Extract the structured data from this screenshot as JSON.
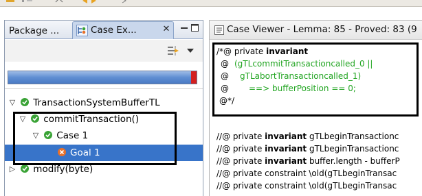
{
  "left_view": {
    "tabs": [
      {
        "label": "Package ..."
      },
      {
        "label": "Case Ex...",
        "active": true,
        "close": "✕"
      }
    ],
    "progress": {
      "value_fraction": 0.97,
      "error_color": "#d41f1f",
      "bar_color": "#5f8ed2"
    },
    "tree": [
      {
        "label": "TransactionSystemBufferTL",
        "status": "green",
        "expanded": true
      },
      {
        "label": "commitTransaction()",
        "status": "green",
        "expanded": true
      },
      {
        "label": "Case 1",
        "status": "green",
        "expanded": true
      },
      {
        "label": "Goal 1",
        "status": "orange",
        "selected": true
      },
      {
        "label": "modify(byte)",
        "status": "green",
        "expanded": false
      }
    ]
  },
  "right_view": {
    "title": "Case Viewer - Lemma: 85 - Proved: 83 (9",
    "code": {
      "l1_prefix": "/*@ private ",
      "l1_keyword": "invariant",
      "l2_at": "@",
      "l2_text": "(gTLcommitTransactioncalled_0 ||",
      "l3_at": "@",
      "l3_text": "gTLabortTransactioncalled_1)",
      "l4_at": "@",
      "l4_text": "==> bufferPosition == 0;",
      "l5": "@*/",
      "lines": [
        {
          "prefix": "//@ private ",
          "keyword": "invariant",
          "rest": " gTLbeginTransactionc"
        },
        {
          "prefix": "//@ private ",
          "keyword": "invariant",
          "rest": " gTLbeginTransactionc"
        },
        {
          "prefix": "//@ private ",
          "keyword": "invariant",
          "rest": " buffer.length - bufferP"
        },
        {
          "prefix": "//@ private constraint \\old(gTLbeginTransac",
          "keyword": "",
          "rest": ""
        },
        {
          "prefix": "//@ private constraint \\old(gTLbeginTransac",
          "keyword": "",
          "rest": ""
        }
      ]
    }
  },
  "colors": {
    "selection": "#3874c9",
    "status_green": "#3aa336",
    "status_orange": "#e8702a",
    "code_green": "#22a522",
    "tab_active": "#c9d7ec"
  },
  "icons": [
    "case-explorer-icon",
    "filter-icon",
    "view-menu-icon",
    "minimize-icon",
    "maximize-icon",
    "case-viewer-icon",
    "proved-status-icon",
    "open-goal-icon",
    "expand-icon",
    "collapse-icon"
  ]
}
